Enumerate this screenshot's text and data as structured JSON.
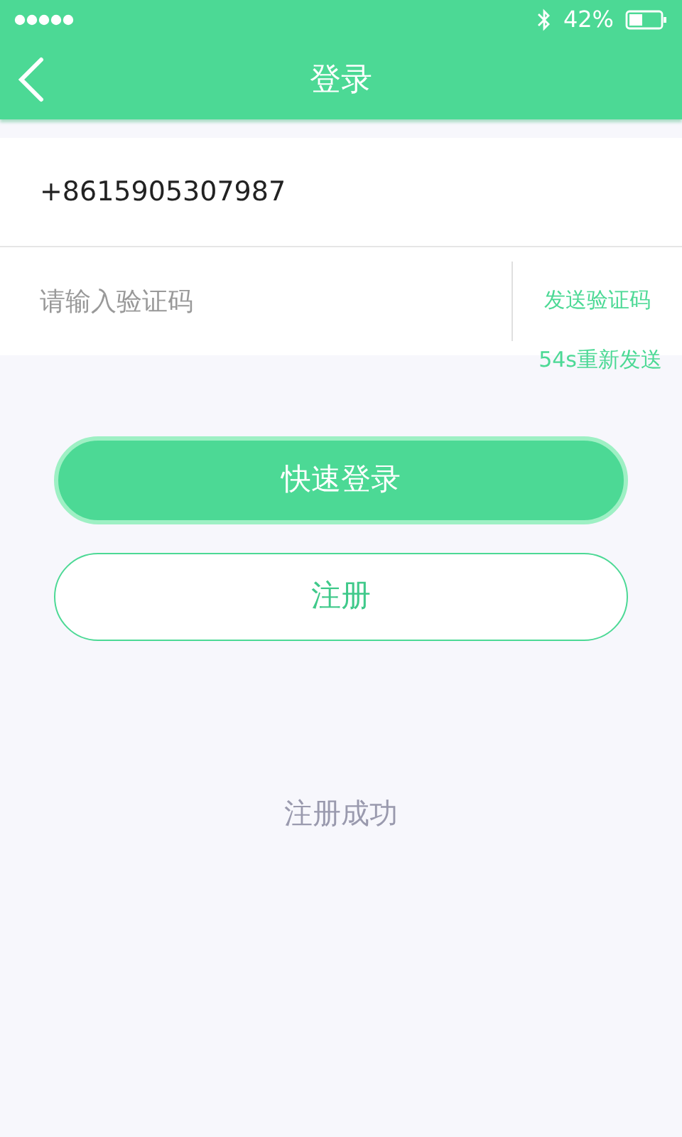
{
  "status_bar": {
    "battery_text": "42%"
  },
  "nav": {
    "title": "登录"
  },
  "phone_field": {
    "value": "+8615905307987"
  },
  "code_field": {
    "placeholder": "请输入验证码",
    "send_button": "发送验证码",
    "countdown": "54s重新发送"
  },
  "buttons": [
    {
      "label": "快速登录",
      "kind": "primary"
    },
    {
      "label": "注册",
      "kind": "outline"
    }
  ],
  "toast": "注册成功"
}
